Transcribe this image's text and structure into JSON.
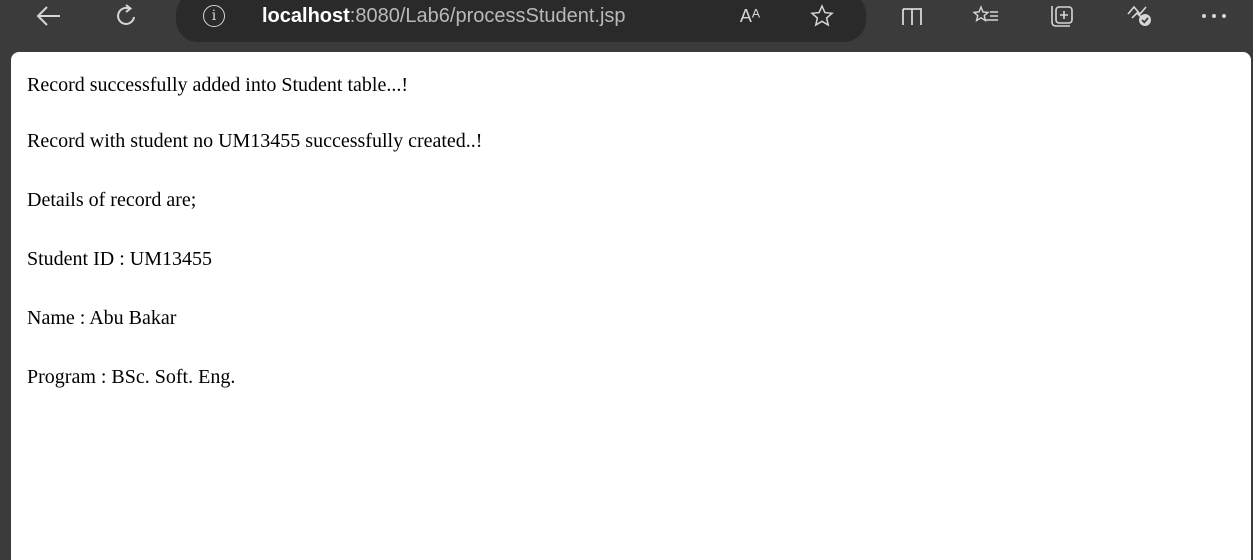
{
  "browser": {
    "url_host": "localhost",
    "url_path": ":8080/Lab6/processStudent.jsp",
    "read_aloud_glyph": "Aᴬ",
    "toolbar_icons": [
      "back-arrow-icon",
      "refresh-icon",
      "site-info-icon",
      "read-aloud-icon",
      "favorite-star-icon",
      "split-screen-icon",
      "favorites-bar-icon",
      "collections-icon",
      "performance-icon",
      "more-options-icon"
    ]
  },
  "page": {
    "messages": [
      "Record successfully added into Student table...!",
      "Record with student no UM13455 successfully created..!",
      "Details of record are;",
      "Student ID : UM13455",
      "Name : Abu Bakar",
      "Program : BSc. Soft. Eng."
    ]
  }
}
